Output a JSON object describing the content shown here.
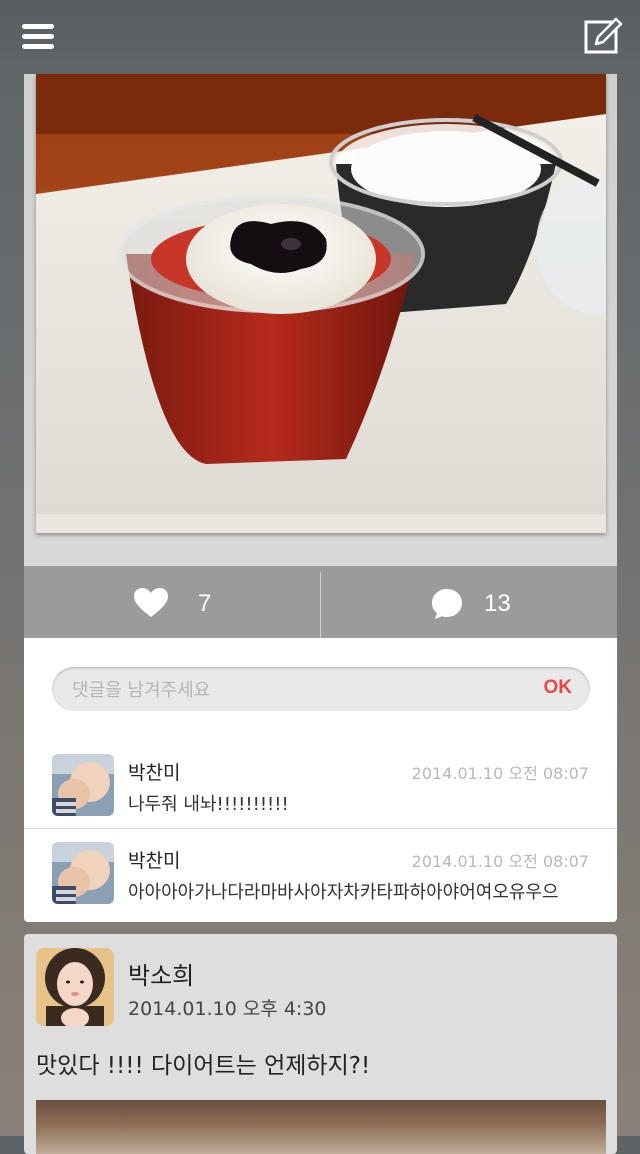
{
  "topbar": {
    "menu_icon": "hamburger-menu-icon",
    "compose_icon": "compose-edit-icon"
  },
  "post": {
    "likes": "7",
    "comments_count": "13",
    "comment_input": {
      "placeholder": "댓글을 남겨주세요",
      "submit_label": "OK"
    },
    "comments": [
      {
        "name": "박찬미",
        "time": "2014.01.10 오전 08:07",
        "text": "나두줘 내놔!!!!!!!!!!"
      },
      {
        "name": "박찬미",
        "time": "2014.01.10 오전 08:07",
        "text": "아아아아가나다라마바사아자차카타파하아야어여오유우으"
      }
    ]
  },
  "next_post": {
    "name": "박소희",
    "time": "2014.01.10 오후 4:30",
    "text": "맛있다 !!!! 다이어트는 언제하지?!"
  },
  "colors": {
    "accent": "#e8474a",
    "action_bar": "#9b9b9b"
  }
}
